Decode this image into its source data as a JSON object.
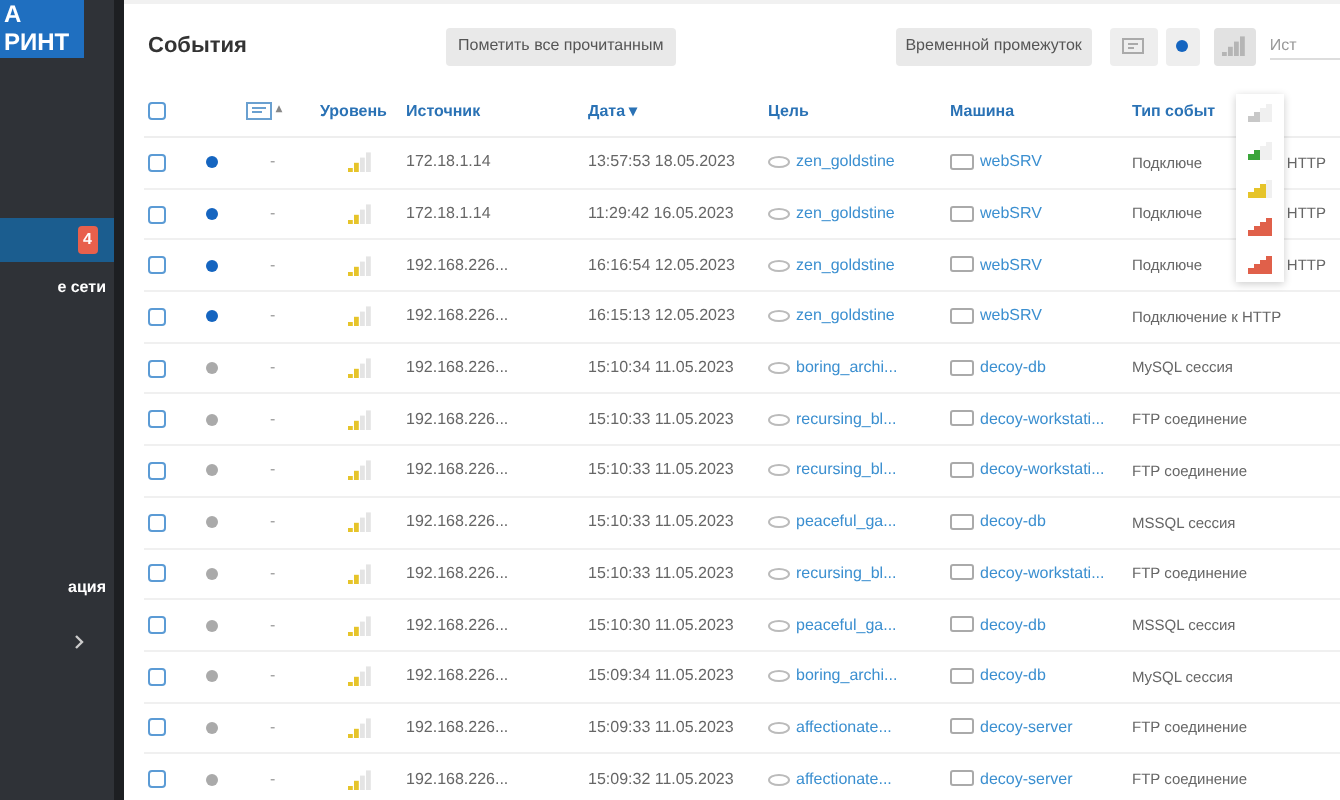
{
  "sidebar": {
    "logo_lines": [
      "А",
      "РИНТ"
    ],
    "items": [
      {
        "badge": "4",
        "selected": true
      },
      {
        "label": "е сети",
        "selected": false
      },
      {
        "label": "ация",
        "selected": false
      }
    ]
  },
  "panel": {
    "title": "События",
    "toolbar": {
      "mark_all_read": "Пометить все прочитанным",
      "time_range": "Временной промежуток",
      "search_placeholder": "Ист"
    },
    "level_menu": [
      {
        "color": "#c8c8c8"
      },
      {
        "color": "#3aa53a"
      },
      {
        "color": "#e6c42a"
      },
      {
        "color": "#e0604a"
      },
      {
        "color": "#e0604a"
      }
    ],
    "select_all_checked": false,
    "columns": {
      "comment_sort": "▴",
      "level": "Уровень",
      "source": "Источник",
      "date": "Дата ▾",
      "target": "Цель",
      "machine": "Машина",
      "type": "Тип событ"
    },
    "rows": [
      {
        "checked": false,
        "unread": true,
        "comment": "-",
        "source": "172.18.1.14",
        "date": "13:57:53 18.05.2023",
        "target": "zen_goldstine",
        "machine": "webSRV",
        "type": [
          "Подключе",
          "HTTP"
        ]
      },
      {
        "checked": false,
        "unread": true,
        "comment": "-",
        "source": "172.18.1.14",
        "date": "11:29:42 16.05.2023",
        "target": "zen_goldstine",
        "machine": "webSRV",
        "type": [
          "Подключе",
          "HTTP"
        ]
      },
      {
        "checked": false,
        "unread": true,
        "comment": "-",
        "source": "192.168.226...",
        "date": "16:16:54 12.05.2023",
        "target": "zen_goldstine",
        "machine": "webSRV",
        "type": [
          "Подключе",
          "HTTP"
        ]
      },
      {
        "checked": false,
        "unread": true,
        "comment": "-",
        "source": "192.168.226...",
        "date": "16:15:13 12.05.2023",
        "target": "zen_goldstine",
        "machine": "webSRV",
        "type": [
          "Подключение к HTTP"
        ]
      },
      {
        "checked": false,
        "unread": false,
        "comment": "-",
        "source": "192.168.226...",
        "date": "15:10:34 11.05.2023",
        "target": "boring_archi...",
        "machine": "decoy-db",
        "type": [
          "MySQL сессия"
        ]
      },
      {
        "checked": false,
        "unread": false,
        "comment": "-",
        "source": "192.168.226...",
        "date": "15:10:33 11.05.2023",
        "target": "recursing_bl...",
        "machine": "decoy-workstati...",
        "type": [
          "FTP соединение"
        ]
      },
      {
        "checked": false,
        "unread": false,
        "comment": "-",
        "source": "192.168.226...",
        "date": "15:10:33 11.05.2023",
        "target": "recursing_bl...",
        "machine": "decoy-workstati...",
        "type": [
          "FTP соединение"
        ]
      },
      {
        "checked": false,
        "unread": false,
        "comment": "-",
        "source": "192.168.226...",
        "date": "15:10:33 11.05.2023",
        "target": "peaceful_ga...",
        "machine": "decoy-db",
        "type": [
          "MSSQL сессия"
        ]
      },
      {
        "checked": false,
        "unread": false,
        "comment": "-",
        "source": "192.168.226...",
        "date": "15:10:33 11.05.2023",
        "target": "recursing_bl...",
        "machine": "decoy-workstati...",
        "type": [
          "FTP соединение"
        ]
      },
      {
        "checked": false,
        "unread": false,
        "comment": "-",
        "source": "192.168.226...",
        "date": "15:10:30 11.05.2023",
        "target": "peaceful_ga...",
        "machine": "decoy-db",
        "type": [
          "MSSQL сессия"
        ]
      },
      {
        "checked": false,
        "unread": false,
        "comment": "-",
        "source": "192.168.226...",
        "date": "15:09:34 11.05.2023",
        "target": "boring_archi...",
        "machine": "decoy-db",
        "type": [
          "MySQL сессия"
        ]
      },
      {
        "checked": false,
        "unread": false,
        "comment": "-",
        "source": "192.168.226...",
        "date": "15:09:33 11.05.2023",
        "target": "affectionate...",
        "machine": "decoy-server",
        "type": [
          "FTP соединение"
        ]
      },
      {
        "checked": false,
        "unread": false,
        "comment": "-",
        "source": "192.168.226...",
        "date": "15:09:32 11.05.2023",
        "target": "affectionate...",
        "machine": "decoy-server",
        "type": [
          "FTP соединение"
        ]
      }
    ]
  }
}
